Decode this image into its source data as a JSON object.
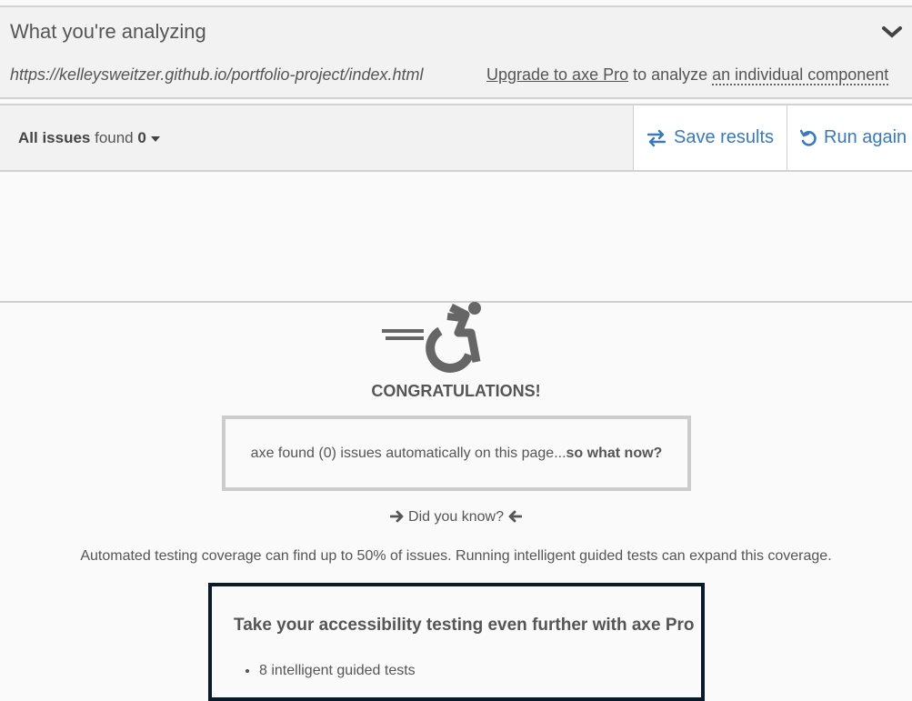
{
  "analyze": {
    "title": "What you're analyzing",
    "url": "https://kelleysweitzer.github.io/portfolio-project/index.html",
    "upgrade_link": "Upgrade to axe Pro",
    "upgrade_text": " to analyze ",
    "component_text": "an individual component"
  },
  "toolbar": {
    "filter_label": "All issues",
    "found_text": " found ",
    "count": "0",
    "save_label": "Save results",
    "run_label": "Run again",
    "accent": "#3a7ab8"
  },
  "result": {
    "congrats": "CONGRATULATIONS!",
    "found_prefix": "axe found (0) issues automatically on this page...",
    "found_bold": "so what now?",
    "did_you_know": " Did you know? ",
    "coverage": "Automated testing coverage can find up to 50% of issues. Running intelligent guided tests can expand this coverage."
  },
  "pro": {
    "title": "Take your accessibility testing even further with axe Pro",
    "items": [
      "8 intelligent guided tests"
    ]
  },
  "icons": [
    "chevron-down-icon",
    "exchange-icon",
    "refresh-icon",
    "accessibility-icon",
    "arrow-right-icon",
    "arrow-left-icon"
  ]
}
